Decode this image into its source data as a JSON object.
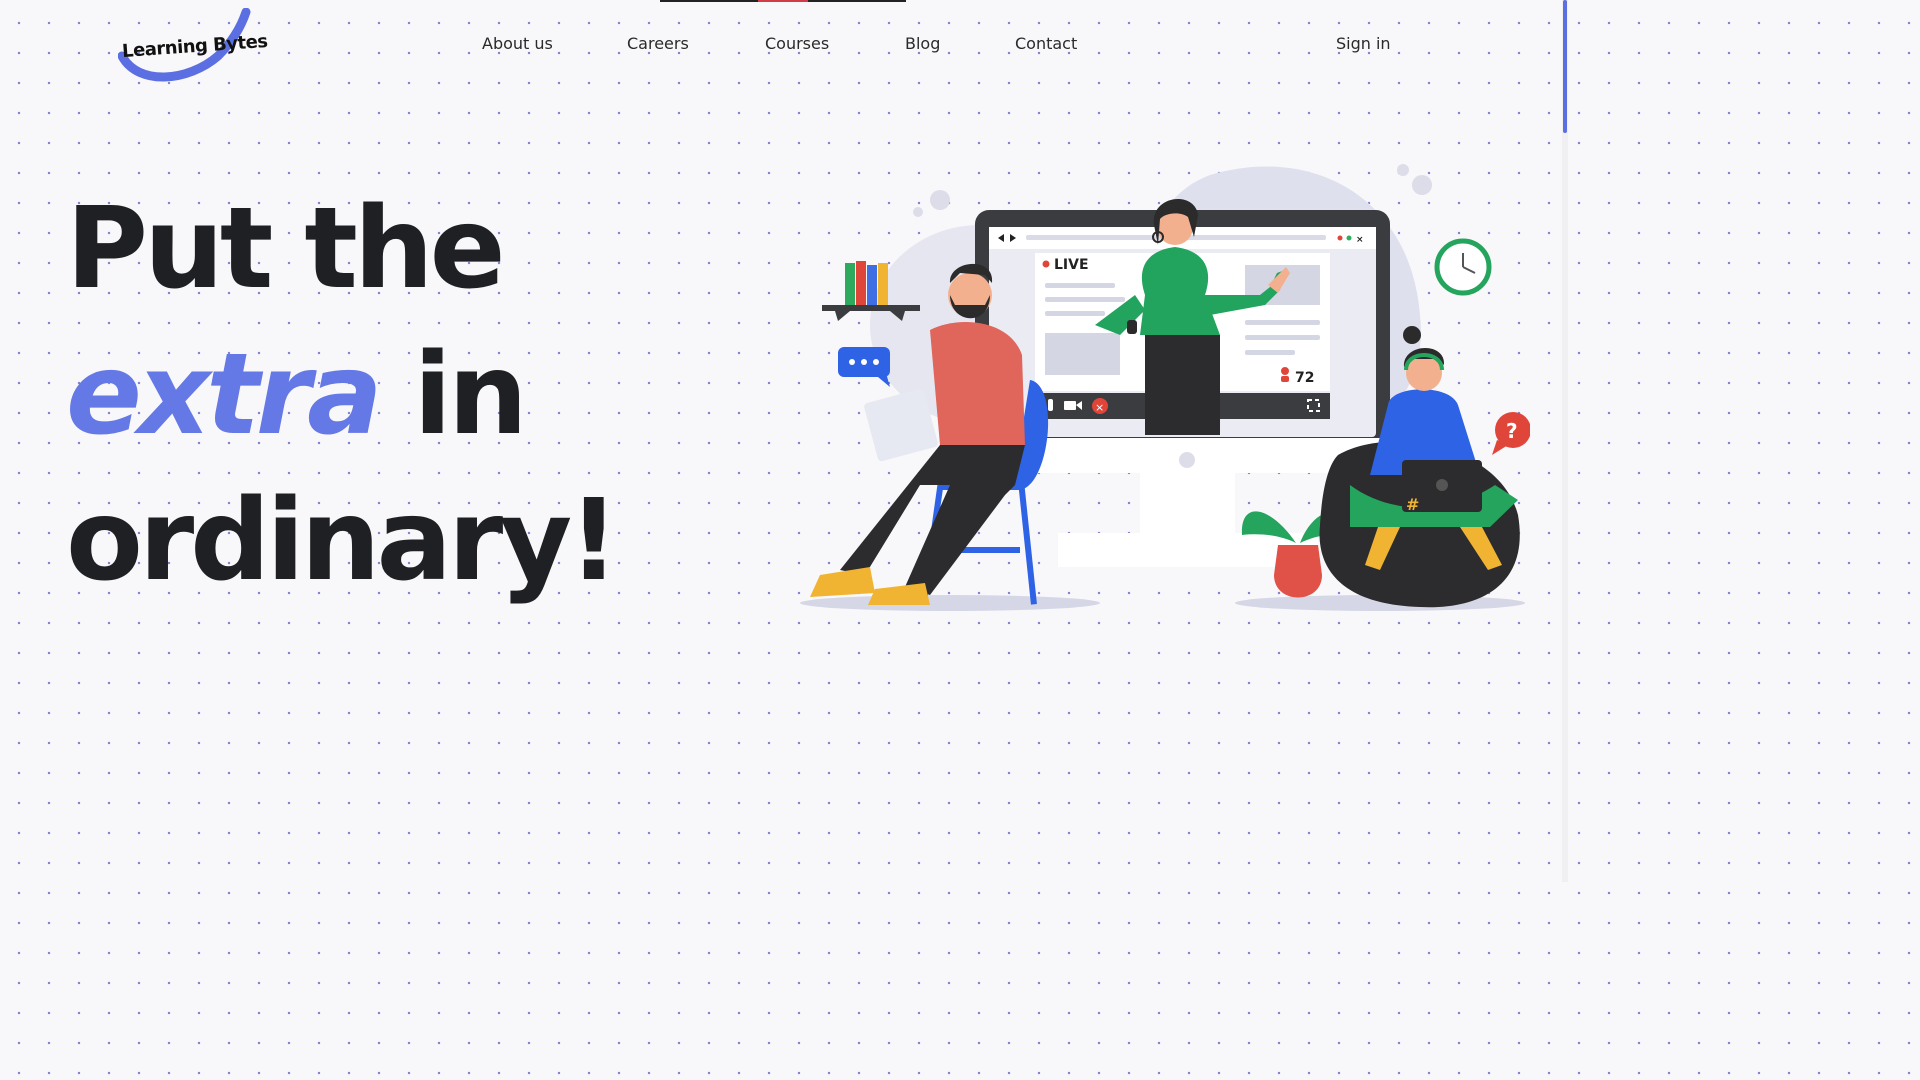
{
  "brand": {
    "name": "Learning Bytes",
    "accent": "#5b6fe3"
  },
  "nav": {
    "items": [
      "About us",
      "Careers",
      "Courses",
      "Blog",
      "Contact"
    ],
    "signin": "Sign in"
  },
  "hero": {
    "line1": "Put the",
    "accent_word": "extra",
    "line2_rest": " in",
    "line3": "ordinary!"
  },
  "illustration": {
    "screen_badge": "LIVE",
    "viewer_count": "72",
    "laptop_symbol": "#",
    "help_symbol": "?"
  },
  "colors": {
    "background": "#f8f7f9",
    "text": "#1e2023",
    "accent": "#6478e6",
    "dots": "#7f7fd6"
  }
}
